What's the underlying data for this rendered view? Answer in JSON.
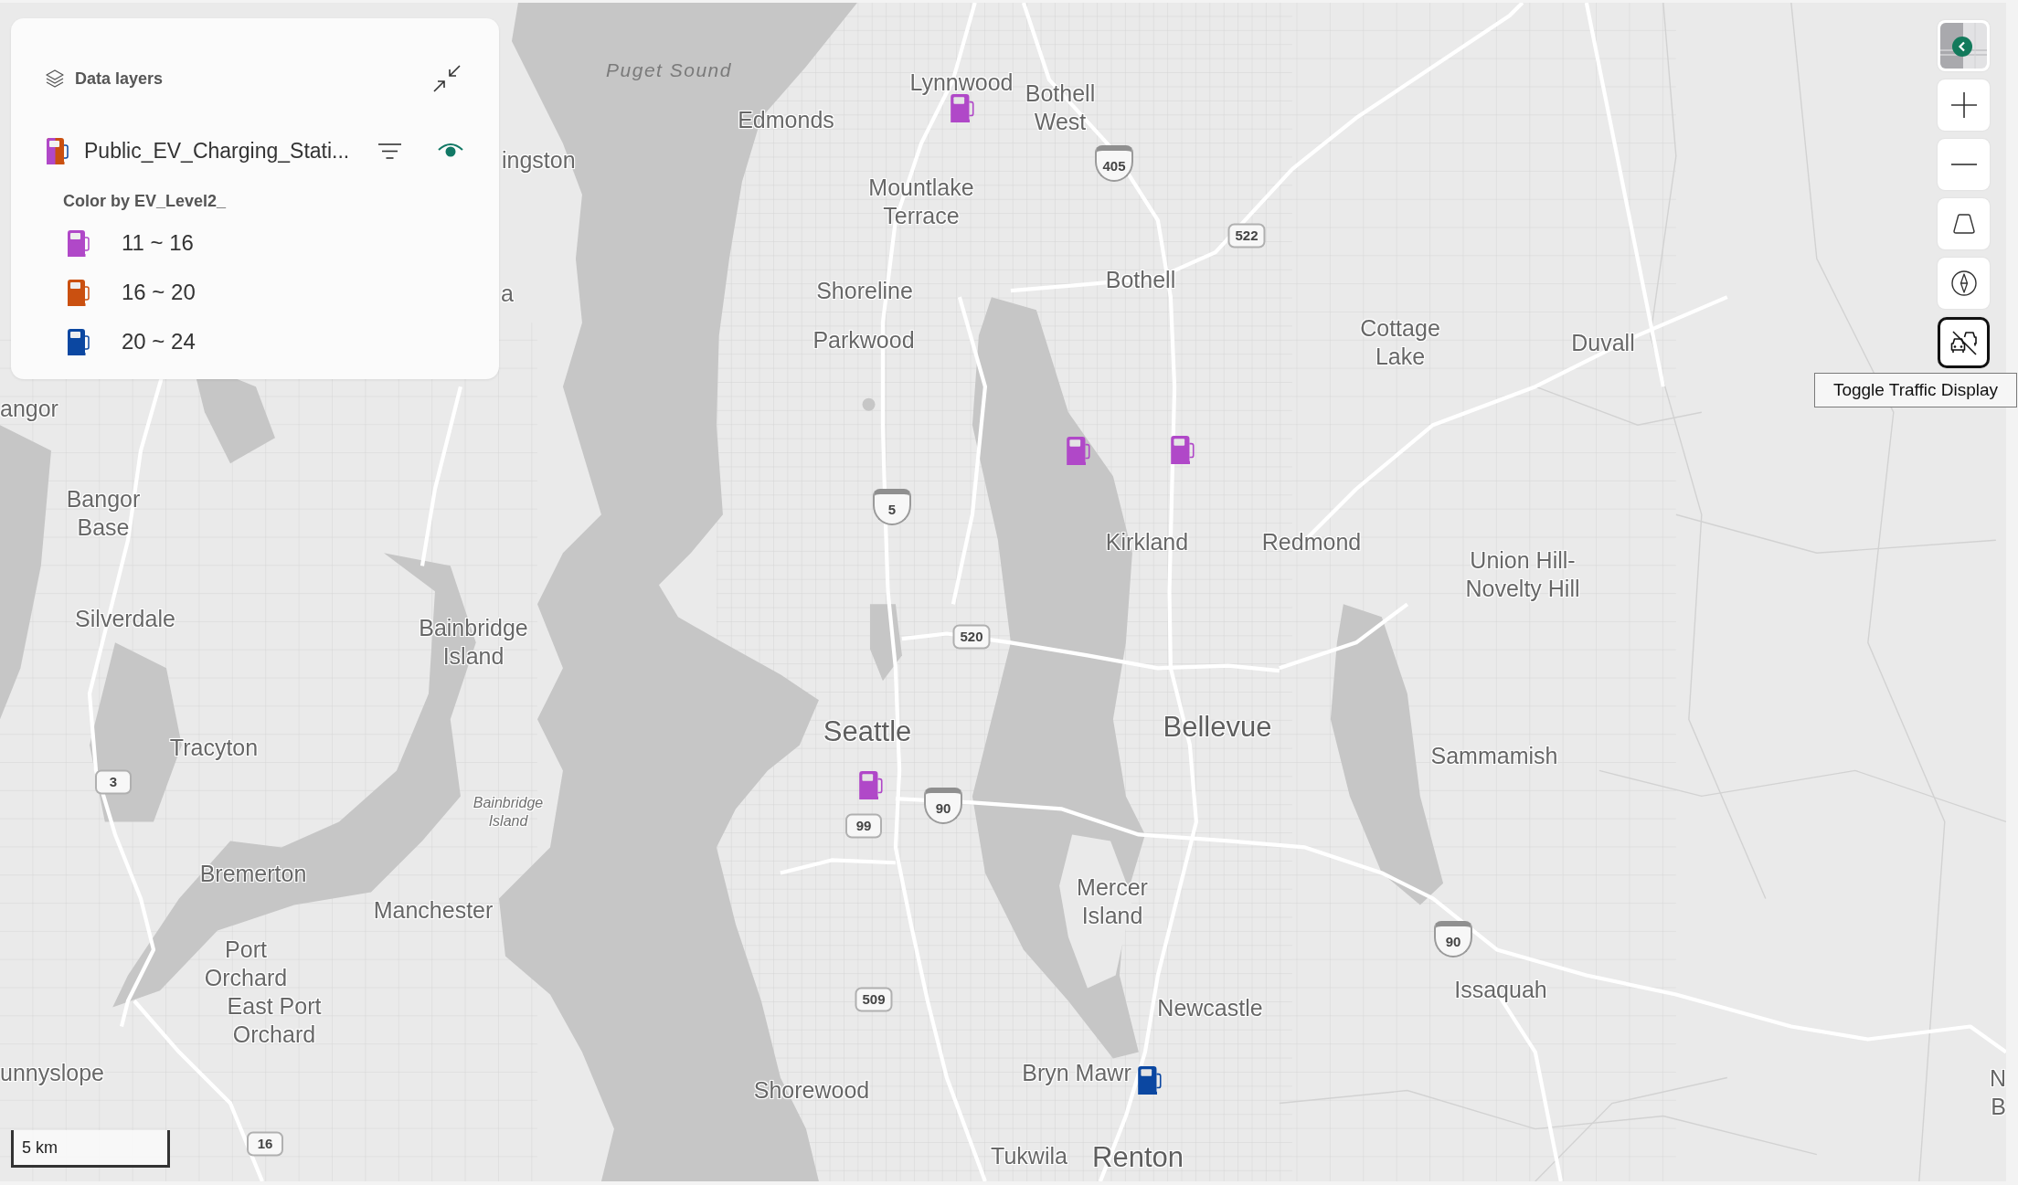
{
  "data_layers_panel": {
    "title": "Data layers",
    "layer": {
      "name": "Public_EV_Charging_Stati...",
      "visible": true
    },
    "legend_title": "Color by EV_Level2_",
    "legend": [
      {
        "label": "11 ~ 16",
        "color": "#b048c8"
      },
      {
        "label": "16 ~ 20",
        "color": "#ca5010"
      },
      {
        "label": "20 ~ 24",
        "color": "#0b47a1"
      }
    ]
  },
  "map": {
    "places": [
      {
        "name": "Puget Sound",
        "kind": "water"
      },
      {
        "name": "Lynnwood",
        "kind": "city"
      },
      {
        "name": "Edmonds",
        "kind": "city"
      },
      {
        "name": "Bothell\nWest",
        "kind": "city"
      },
      {
        "name": "ingston",
        "kind": "city"
      },
      {
        "name": "Mountlake\nTerrace",
        "kind": "city"
      },
      {
        "name": "a",
        "kind": "city"
      },
      {
        "name": "Shoreline",
        "kind": "city"
      },
      {
        "name": "Bothell",
        "kind": "city"
      },
      {
        "name": "Parkwood",
        "kind": "city"
      },
      {
        "name": "Cottage\nLake",
        "kind": "city"
      },
      {
        "name": "Duvall",
        "kind": "city"
      },
      {
        "name": "angor",
        "kind": "city"
      },
      {
        "name": "Bangor\nBase",
        "kind": "city"
      },
      {
        "name": "Kirkland",
        "kind": "city"
      },
      {
        "name": "Redmond",
        "kind": "city"
      },
      {
        "name": "Union Hill-\nNovelty Hill",
        "kind": "city"
      },
      {
        "name": "Silverdale",
        "kind": "city"
      },
      {
        "name": "Bainbridge\nIsland",
        "kind": "city"
      },
      {
        "name": "Tracyton",
        "kind": "city"
      },
      {
        "name": "Seattle",
        "kind": "major"
      },
      {
        "name": "Bellevue",
        "kind": "major"
      },
      {
        "name": "Sammamish",
        "kind": "city"
      },
      {
        "name": "Bainbridge\nIsland",
        "kind": "island"
      },
      {
        "name": "Bremerton",
        "kind": "city"
      },
      {
        "name": "Manchester",
        "kind": "city"
      },
      {
        "name": "Mercer\nIsland",
        "kind": "city"
      },
      {
        "name": "Port\nOrchard",
        "kind": "city"
      },
      {
        "name": "East Port\nOrchard",
        "kind": "city"
      },
      {
        "name": "Newcastle",
        "kind": "city"
      },
      {
        "name": "Issaquah",
        "kind": "city"
      },
      {
        "name": "unnyslope",
        "kind": "city"
      },
      {
        "name": "Shorewood",
        "kind": "city"
      },
      {
        "name": "Bryn Mawr",
        "kind": "city"
      },
      {
        "name": "N",
        "kind": "city"
      },
      {
        "name": "B",
        "kind": "city"
      },
      {
        "name": "Tukwila",
        "kind": "city"
      },
      {
        "name": "Renton",
        "kind": "major"
      }
    ],
    "highway_shields": [
      {
        "number": "405",
        "kind": "interstate"
      },
      {
        "number": "522",
        "kind": "state"
      },
      {
        "number": "5",
        "kind": "interstate"
      },
      {
        "number": "520",
        "kind": "state"
      },
      {
        "number": "3",
        "kind": "state"
      },
      {
        "number": "99",
        "kind": "state"
      },
      {
        "number": "90",
        "kind": "interstate"
      },
      {
        "number": "90",
        "kind": "interstate"
      },
      {
        "number": "509",
        "kind": "state"
      },
      {
        "number": "16",
        "kind": "state"
      }
    ],
    "markers": [
      {
        "color": "#b048c8"
      },
      {
        "color": "#b048c8"
      },
      {
        "color": "#b048c8"
      },
      {
        "color": "#b048c8"
      },
      {
        "color": "#0b47a1"
      }
    ]
  },
  "map_controls": {
    "buttons": [
      {
        "kind": "style-picker",
        "focused": false
      },
      {
        "kind": "zoom-in",
        "focused": false
      },
      {
        "kind": "zoom-out",
        "focused": false
      },
      {
        "kind": "pitch",
        "focused": false
      },
      {
        "kind": "compass",
        "focused": false
      },
      {
        "kind": "traffic",
        "focused": true
      }
    ],
    "tooltip": "Toggle Traffic Display"
  },
  "scale_bar": {
    "label": "5 km"
  }
}
